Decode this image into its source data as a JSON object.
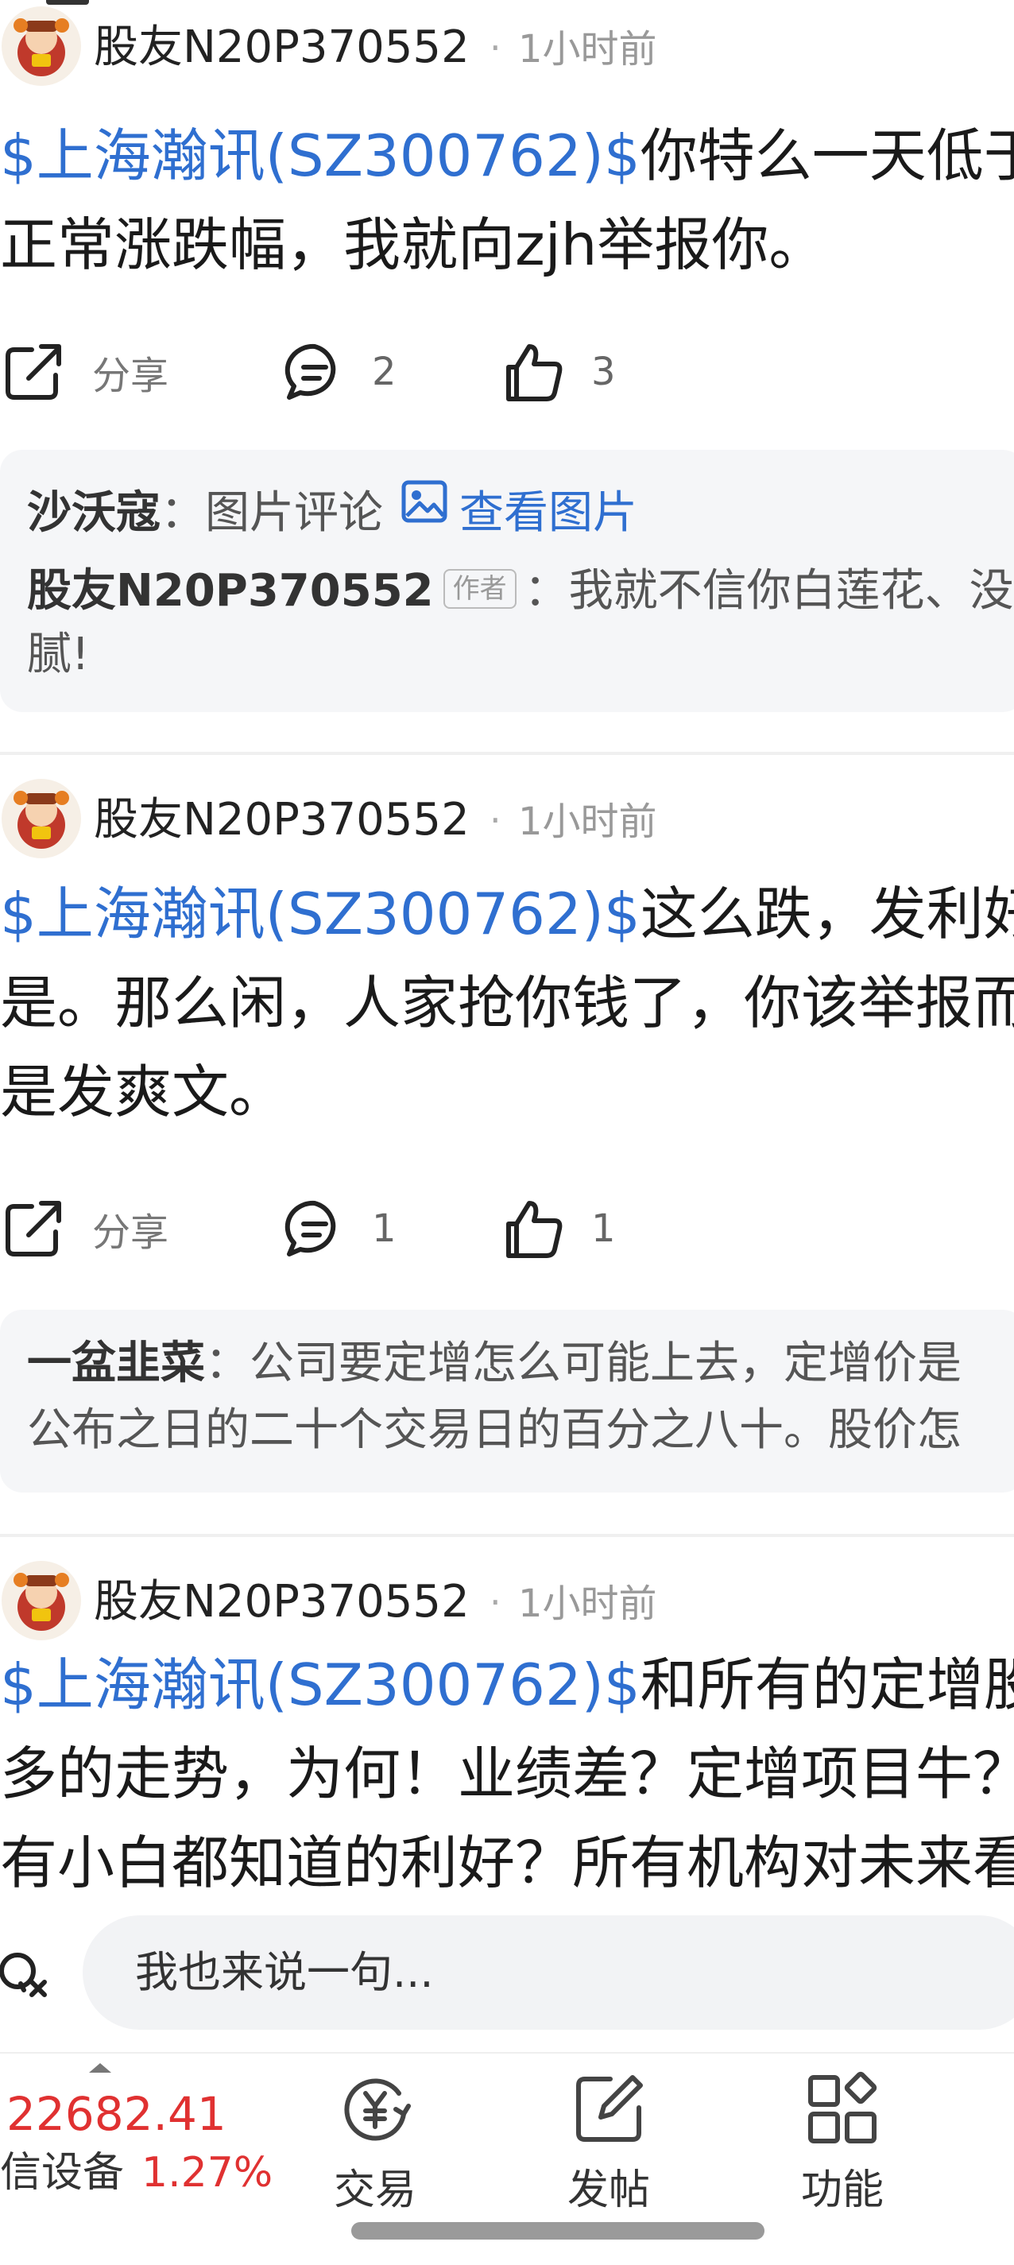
{
  "feed": {
    "posts": [
      {
        "username": "股友N20P370552",
        "time": "1小时前",
        "stock_tag": "$上海瀚讯(SZ300762)$",
        "line1_rest": "你特么一天低于",
        "lines": [
          "正常涨跌幅，我就向zjh举报你。"
        ],
        "share_label": "分享",
        "comment_count": "2",
        "like_count": "3",
        "comments": [
          {
            "name": "沙沃寇",
            "sep": "：图片评论",
            "link": "查看图片"
          },
          {
            "name": "股友N20P370552",
            "author_tag": "作者",
            "text": "：我就不信你白莲花、没",
            "cont": "腻!"
          }
        ]
      },
      {
        "username": "股友N20P370552",
        "time": "1小时前",
        "stock_tag": "$上海瀚讯(SZ300762)$",
        "line1_rest": "这么跌，发利好",
        "lines": [
          "是。那么闲，人家抢你钱了，你该举报而",
          "是发爽文。"
        ],
        "share_label": "分享",
        "comment_count": "1",
        "like_count": "1",
        "comments": [
          {
            "name": "一盆韭菜",
            "text": "：公司要定增怎么可能上去，定增价是",
            "cont": "公布之日的二十个交易日的百分之八十。股价怎"
          }
        ]
      },
      {
        "username": "股友N20P370552",
        "time": "1小时前",
        "stock_tag": "$上海瀚讯(SZ300762)$",
        "line1_rest": "和所有的定增股",
        "lines": [
          "多的走势，为何！业绩差？定增项目牛？",
          "有小白都知道的利好？所有机构对未来看"
        ]
      }
    ]
  },
  "input": {
    "placeholder": "我也来说一句..."
  },
  "ticker": {
    "value": "22682.41",
    "name": "信设备",
    "change": "1.27%"
  },
  "nav": {
    "trade": "交易",
    "post": "发帖",
    "functions": "功能"
  },
  "colors": {
    "stock_tag": "#2f6fd0",
    "up": "#e03131"
  },
  "icons": [
    "avatar",
    "share-icon",
    "comment-icon",
    "like-icon",
    "image-icon",
    "emoji-search-icon",
    "trade-icon",
    "post-icon",
    "functions-icon"
  ]
}
